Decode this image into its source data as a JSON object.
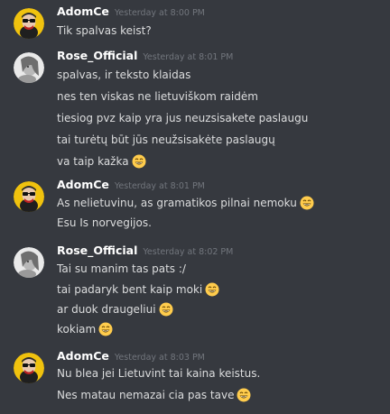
{
  "groups": [
    {
      "author": "AdomCe",
      "time": "Yesterday at 8:00 PM",
      "avatar_icon": "avatar-dark-glasses-icon",
      "messages": [
        {
          "text": "Tik spalvas keist?",
          "emoji": false
        }
      ]
    },
    {
      "author": "Rose_Official",
      "time": "Yesterday at 8:01 PM",
      "avatar_icon": "avatar-grey-portrait-icon",
      "messages": [
        {
          "text": "spalvas, ir teksto klaidas",
          "emoji": false
        },
        {
          "text": "nes ten viskas ne lietuviškom raidėm",
          "emoji": false
        },
        {
          "text": "tiesiog pvz kaip yra jus neuzsisakete paslaugu",
          "emoji": false
        },
        {
          "text": "tai turėtų būt jūs neužsisakėte paslaugų",
          "emoji": false
        },
        {
          "text": "va taip kažka",
          "emoji": true
        }
      ]
    },
    {
      "author": "AdomCe",
      "time": "Yesterday at 8:01 PM",
      "avatar_icon": "avatar-dark-glasses-icon",
      "messages": [
        {
          "text": "As nelietuvinu,  as gramatikos pilnai nemoku",
          "emoji": true
        },
        {
          "text": "Esu Is norvegijos.",
          "emoji": false
        }
      ]
    },
    {
      "author": "Rose_Official",
      "time": "Yesterday at 8:02 PM",
      "avatar_icon": "avatar-grey-portrait-icon",
      "messages": [
        {
          "text": "Tai su manim tas pats :/",
          "emoji": false
        },
        {
          "text": "tai padaryk bent kaip moki",
          "emoji": true
        },
        {
          "text": "ar duok draugeliui",
          "emoji": true
        },
        {
          "text": "kokiam",
          "emoji": true
        }
      ]
    },
    {
      "author": "AdomCe",
      "time": "Yesterday at 8:03 PM",
      "avatar_icon": "avatar-dark-glasses-icon",
      "messages": [
        {
          "text": "Nu blea jei Lietuvint tai kaina keistus.",
          "emoji": false
        },
        {
          "text": "Nes matau nemazai cia pas tave",
          "emoji": true
        }
      ]
    }
  ],
  "emoji_icon": "grinning-face-icon",
  "colors": {
    "background": "#36393f",
    "username": "#ffffff",
    "timestamp": "#72767d",
    "message_text": "#dcddde",
    "avatar_yellow": "#f0c20e",
    "emoji_yellow": "#ffcc4d"
  }
}
